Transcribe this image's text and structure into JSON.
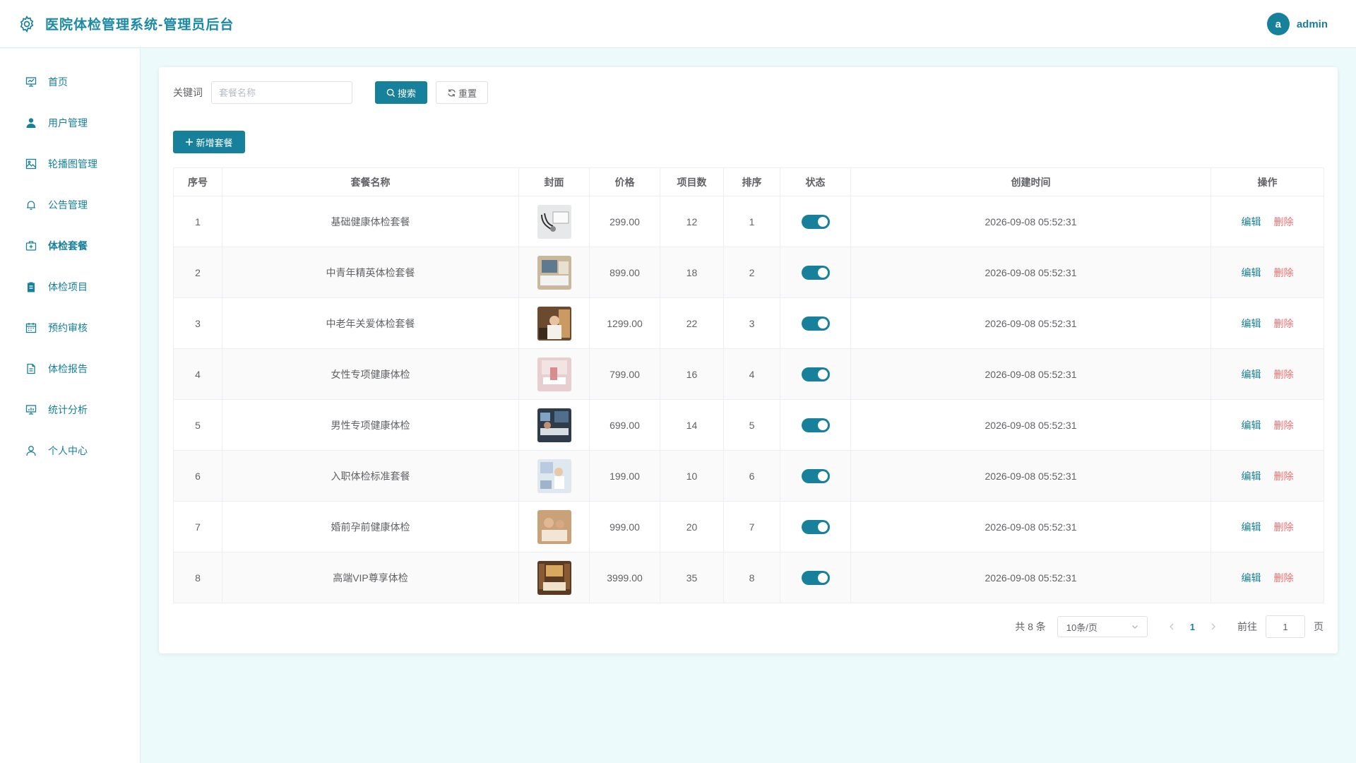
{
  "app": {
    "title": "医院体检管理系统-管理员后台"
  },
  "user": {
    "avatar_letter": "a",
    "name": "admin"
  },
  "sidebar": {
    "items": [
      {
        "label": "首页",
        "icon": "presentation-board-icon",
        "active": false
      },
      {
        "label": "用户管理",
        "icon": "user-icon",
        "active": false
      },
      {
        "label": "轮播图管理",
        "icon": "image-icon",
        "active": false
      },
      {
        "label": "公告管理",
        "icon": "bell-icon",
        "active": false
      },
      {
        "label": "体检套餐",
        "icon": "medical-kit-icon",
        "active": true
      },
      {
        "label": "体检项目",
        "icon": "clipboard-icon",
        "active": false
      },
      {
        "label": "预约审核",
        "icon": "calendar-icon",
        "active": false
      },
      {
        "label": "体检报告",
        "icon": "document-icon",
        "active": false
      },
      {
        "label": "统计分析",
        "icon": "chart-board-icon",
        "active": false
      },
      {
        "label": "个人中心",
        "icon": "profile-icon",
        "active": false
      }
    ]
  },
  "search": {
    "label": "关键词",
    "placeholder": "套餐名称",
    "value": "",
    "search_label": "搜索",
    "reset_label": "重置"
  },
  "toolbar": {
    "add_label": "新增套餐"
  },
  "table": {
    "headers": {
      "index": "序号",
      "name": "套餐名称",
      "cover": "封面",
      "price": "价格",
      "items": "项目数",
      "sort": "排序",
      "status": "状态",
      "created": "创建时间",
      "actions": "操作"
    },
    "edit_label": "编辑",
    "delete_label": "删除",
    "rows": [
      {
        "index": "1",
        "name": "基础健康体检套餐",
        "price": "299.00",
        "items": "12",
        "sort": "1",
        "status": true,
        "created": "2026-09-08 05:52:31"
      },
      {
        "index": "2",
        "name": "中青年精英体检套餐",
        "price": "899.00",
        "items": "18",
        "sort": "2",
        "status": true,
        "created": "2026-09-08 05:52:31"
      },
      {
        "index": "3",
        "name": "中老年关爱体检套餐",
        "price": "1299.00",
        "items": "22",
        "sort": "3",
        "status": true,
        "created": "2026-09-08 05:52:31"
      },
      {
        "index": "4",
        "name": "女性专项健康体检",
        "price": "799.00",
        "items": "16",
        "sort": "4",
        "status": true,
        "created": "2026-09-08 05:52:31"
      },
      {
        "index": "5",
        "name": "男性专项健康体检",
        "price": "699.00",
        "items": "14",
        "sort": "5",
        "status": true,
        "created": "2026-09-08 05:52:31"
      },
      {
        "index": "6",
        "name": "入职体检标准套餐",
        "price": "199.00",
        "items": "10",
        "sort": "6",
        "status": true,
        "created": "2026-09-08 05:52:31"
      },
      {
        "index": "7",
        "name": "婚前孕前健康体检",
        "price": "999.00",
        "items": "20",
        "sort": "7",
        "status": true,
        "created": "2026-09-08 05:52:31"
      },
      {
        "index": "8",
        "name": "高端VIP尊享体检",
        "price": "3999.00",
        "items": "35",
        "sort": "8",
        "status": true,
        "created": "2026-09-08 05:52:31"
      }
    ]
  },
  "pagination": {
    "total_text": "共 8 条",
    "page_size": "10条/页",
    "current_page": "1",
    "goto_label": "前往",
    "goto_value": "1",
    "page_suffix": "页"
  },
  "colors": {
    "primary": "#17809b",
    "danger": "#f56c6c",
    "background": "#ecfafc"
  }
}
